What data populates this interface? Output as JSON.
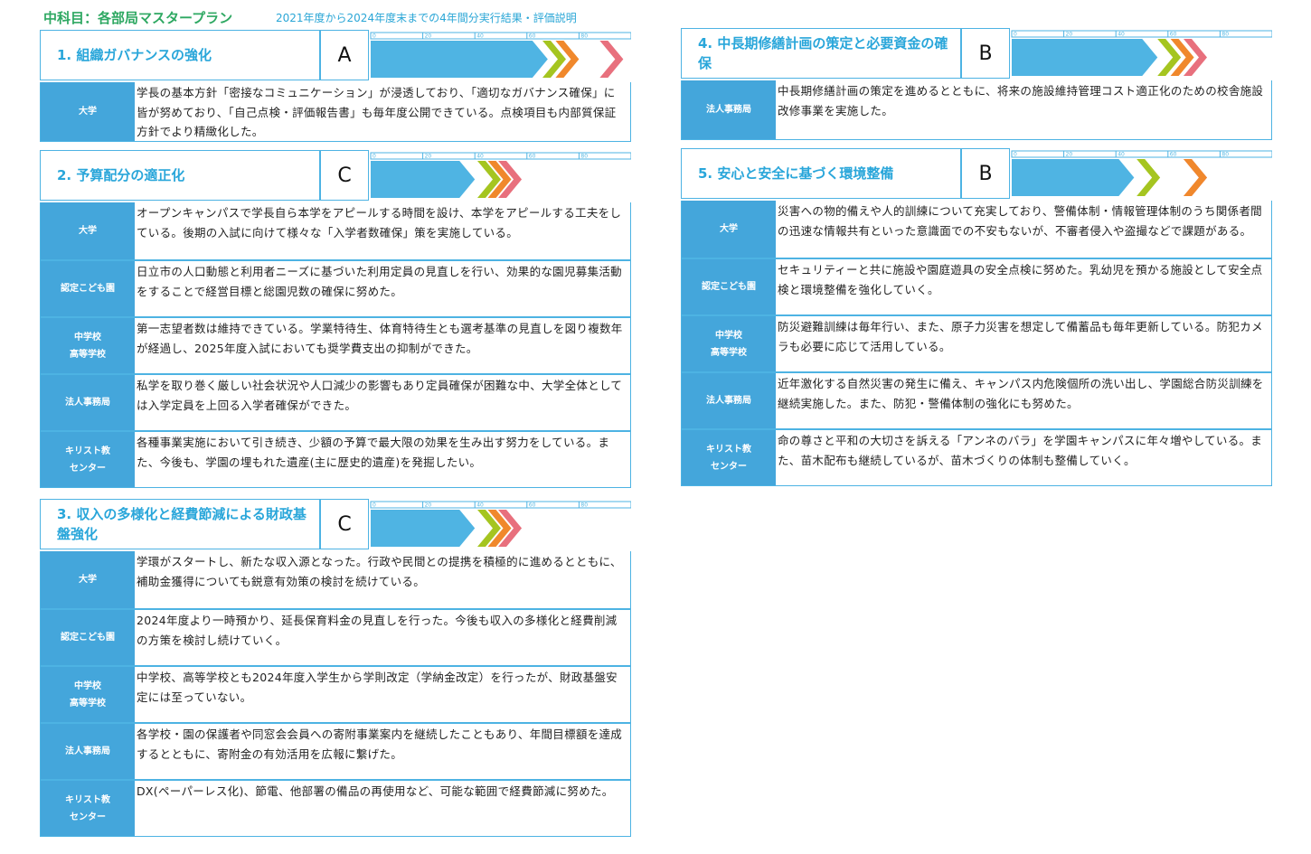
{
  "header": {
    "title": "中科目：各部局マスタープラン",
    "subtitle": "2021年度から2024年度末までの4年間分実行結果・評価説明"
  },
  "scale_ticks": [
    "0",
    "20",
    "40",
    "60",
    "80",
    "100"
  ],
  "colors": {
    "blue": "#4fb4e3",
    "green": "#a5c520",
    "orange": "#f0882c",
    "pink": "#e8707d",
    "frame": "#4db3e3"
  },
  "sections": [
    {
      "title": "1. 組織ガバナンスの強化",
      "grade": "A",
      "progress": [
        {
          "level": "blue",
          "value": 68
        },
        {
          "level": "green",
          "value": 75
        },
        {
          "level": "orange",
          "value": 80
        },
        {
          "level": "pink",
          "value": 97
        }
      ],
      "rows": [
        {
          "label": "大学",
          "text": "学長の基本方針「密接なコミュニケーション」が浸透しており、「適切なガバナンス確保」に皆が努めており、「自己点検・評価報告書」も毎年度公開できている。点検項目も内部質保証方針でより精緻化した。"
        }
      ]
    },
    {
      "title": "2. 予算配分の適正化",
      "grade": "C",
      "progress": [
        {
          "level": "blue",
          "value": 40
        },
        {
          "level": "green",
          "value": 50
        },
        {
          "level": "orange",
          "value": 54
        },
        {
          "level": "pink",
          "value": 58
        }
      ],
      "rows": [
        {
          "label": "大学",
          "text": "オープンキャンパスで学長自ら本学をアピールする時間を設け、本学をアピールする工夫をしている。後期の入試に向けて様々な「入学者数確保」策を実施している。"
        },
        {
          "label": "認定こども園",
          "text": "日立市の人口動態と利用者ニーズに基づいた利用定員の見直しを行い、効果的な園児募集活動をすることで経営目標と総園児数の確保に努めた。"
        },
        {
          "label": "中学校\n高等学校",
          "text": "第一志望者数は維持できている。学業特待生、体育特待生とも選考基準の見直しを図り複数年が経過し、2025年度入試においても奨学費支出の抑制ができた。"
        },
        {
          "label": "法人事務局",
          "text": "私学を取り巻く厳しい社会状況や人口減少の影響もあり定員確保が困難な中、大学全体としては入学定員を上回る入学者確保ができた。"
        },
        {
          "label": "キリスト教\nセンター",
          "text": "各種事業実施において引き続き、少額の予算で最大限の効果を生み出す努力をしている。また、今後も、学園の埋もれた遺産(主に歴史的遺産)を発掘したい。"
        }
      ]
    },
    {
      "title": "3. 収入の多様化と経費節減による財政基盤強化",
      "grade": "C",
      "progress": [
        {
          "level": "blue",
          "value": 40
        },
        {
          "level": "green",
          "value": 50
        },
        {
          "level": "orange",
          "value": 54
        },
        {
          "level": "pink",
          "value": 58
        }
      ],
      "rows": [
        {
          "label": "大学",
          "text": "学環がスタートし、新たな収入源となった。行政や民間との提携を積極的に進めるとともに、補助金獲得についても鋭意有効策の検討を続けている。"
        },
        {
          "label": "認定こども園",
          "text": "2024年度より一時預かり、延長保育料金の見直しを行った。今後も収入の多様化と経費削減の方策を検討し続けていく。"
        },
        {
          "label": "中学校\n高等学校",
          "text": "中学校、高等学校とも2024年度入学生から学則改定（学納金改定）を行ったが、財政基盤安定には至っていない。"
        },
        {
          "label": "法人事務局",
          "text": "各学校・園の保護者や同窓会会員への寄附事業案内を継続したこともあり、年間目標額を達成するとともに、寄附金の有効活用を広報に繋げた。"
        },
        {
          "label": "キリスト教\nセンター",
          "text": "DX(ペーパーレス化)、節電、他部署の備品の再使用など、可能な範囲で経費節減に努めた。"
        }
      ]
    },
    {
      "title": "4. 中長期修繕計画の策定と必要資金の確保",
      "grade": "B",
      "progress": [
        {
          "level": "blue",
          "value": 56
        },
        {
          "level": "green",
          "value": 65
        },
        {
          "level": "orange",
          "value": 70
        },
        {
          "level": "pink",
          "value": 75
        }
      ],
      "rows": [
        {
          "label": "法人事務局",
          "text": "中長期修繕計画の策定を進めるとともに、将来の施設維持管理コスト適正化のための校舎施設改修事業を実施した。"
        }
      ]
    },
    {
      "title": "5. 安心と安全に基づく環境整備",
      "grade": "B",
      "progress": [
        {
          "level": "blue",
          "value": 47
        },
        {
          "level": "green",
          "value": 57
        },
        {
          "level": "orange",
          "value": 75
        },
        {
          "level": "pink",
          "value": 75
        }
      ],
      "rows": [
        {
          "label": "大学",
          "text": "災害への物的備えや人的訓練について充実しており、警備体制・情報管理体制のうち関係者間の迅速な情報共有といった意識面での不安もないが、不審者侵入や盗撮などで課題がある。"
        },
        {
          "label": "認定こども園",
          "text": "セキュリティーと共に施設や園庭遊具の安全点検に努めた。乳幼児を預かる施設として安全点検と環境整備を強化していく。"
        },
        {
          "label": "中学校\n高等学校",
          "text": "防災避難訓練は毎年行い、また、原子力災害を想定して備蓄品も毎年更新している。防犯カメラも必要に応じて活用している。"
        },
        {
          "label": "法人事務局",
          "text": "近年激化する自然災害の発生に備え、キャンパス内危険個所の洗い出し、学園総合防災訓練を継続実施した。また、防犯・警備体制の強化にも努めた。"
        },
        {
          "label": "キリスト教\nセンター",
          "text": "命の尊さと平和の大切さを訴える「アンネのバラ」を学園キャンパスに年々増やしている。また、苗木配布も継続しているが、苗木づくりの体制も整備していく。"
        }
      ]
    }
  ]
}
